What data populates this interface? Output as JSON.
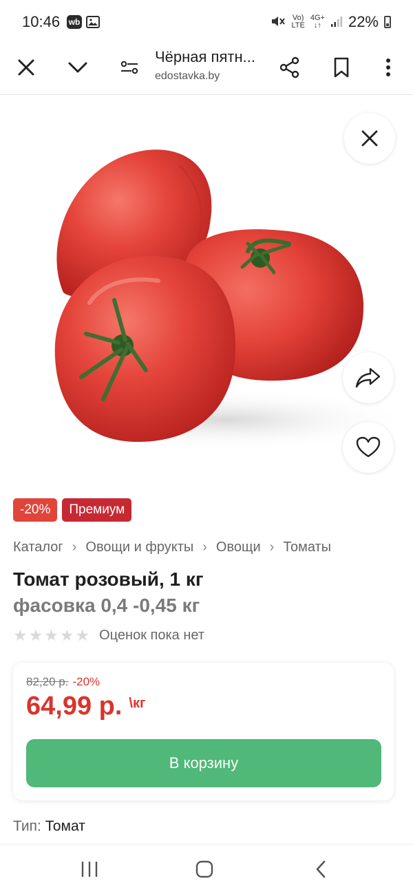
{
  "status_bar": {
    "time": "10:46",
    "app_badge": "wb",
    "network_top": "Vo)",
    "network_bottom": "LTE",
    "net2_top": "4G+",
    "net2_bottom": "↓↑",
    "battery": "22%"
  },
  "browser": {
    "title": "Чёрная пятн...",
    "url": "edostavka.by"
  },
  "badges": {
    "discount": "-20%",
    "premium": "Премиум"
  },
  "breadcrumb": [
    "Каталог",
    "Овощи и фрукты",
    "Овощи",
    "Томаты"
  ],
  "product": {
    "title": "Томат розовый, 1 кг",
    "subtitle": "фасовка 0,4 -0,45 кг",
    "rating_stars": 0,
    "rating_text": "Оценок пока нет"
  },
  "price": {
    "old_price": "82,20 р.",
    "old_discount": "-20%",
    "current": "64,99 р.",
    "unit": "\\кг"
  },
  "cart_button": "В корзину",
  "attributes": {
    "type_label": "Тип:",
    "type_value": "Томат"
  },
  "colors": {
    "discount_red": "#e0453a",
    "premium_red": "#c62932",
    "price_red": "#d8342b",
    "cart_green": "#50b878"
  }
}
